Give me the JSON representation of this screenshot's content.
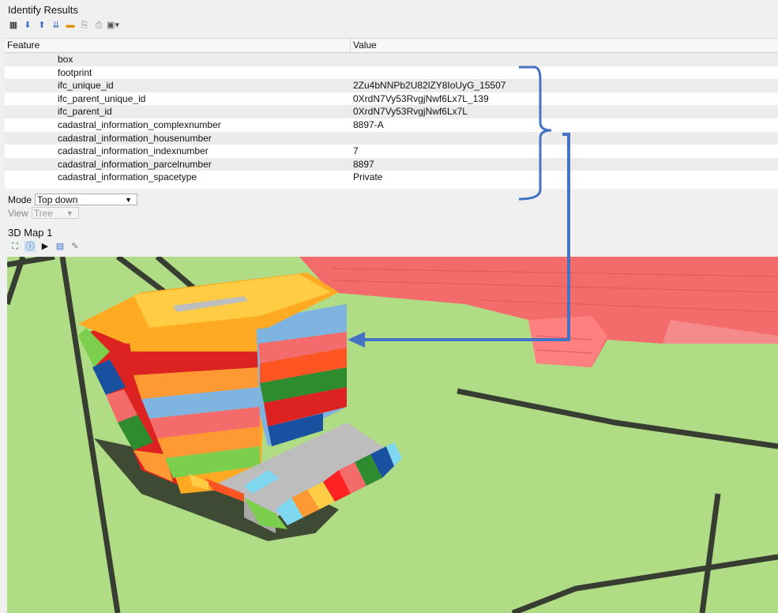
{
  "identify": {
    "title": "Identify Results",
    "toolbar_icons": [
      "expand-tree-icon",
      "collapse-tree-icon",
      "expand-new-icon",
      "expand-all-icon",
      "clear-results-icon",
      "copy-feature-icon",
      "print-icon",
      "select-features-icon"
    ]
  },
  "table": {
    "headers": {
      "feature": "Feature",
      "value": "Value"
    },
    "rows": [
      {
        "feature": "box",
        "value": ""
      },
      {
        "feature": "footprint",
        "value": ""
      },
      {
        "feature": "ifc_unique_id",
        "value": "2Zu4bNNPb2U82lZY8IoUyG_15507"
      },
      {
        "feature": "ifc_parent_unique_id",
        "value": "0XrdN7Vy53RvgjNwf6Lx7L_139"
      },
      {
        "feature": "ifc_parent_id",
        "value": "0XrdN7Vy53RvgjNwf6Lx7L"
      },
      {
        "feature": "cadastral_information_complexnumber",
        "value": "8897-A"
      },
      {
        "feature": "cadastral_information_housenumber",
        "value": ""
      },
      {
        "feature": "cadastral_information_indexnumber",
        "value": "7"
      },
      {
        "feature": "cadastral_information_parcelnumber",
        "value": "8897"
      },
      {
        "feature": "cadastral_information_spacetype",
        "value": "Private"
      }
    ]
  },
  "mode": {
    "label": "Mode",
    "value": "Top down"
  },
  "view": {
    "label": "View",
    "value": "Tree"
  },
  "map": {
    "title": "3D Map 1",
    "toolbar_icons": [
      "camera-icon",
      "identify-icon",
      "play-icon",
      "export-icon",
      "measure-icon"
    ]
  },
  "colors": {
    "annotation": "#4472c4",
    "ground": "#b0dc85",
    "buildings": "#f46b6b"
  }
}
